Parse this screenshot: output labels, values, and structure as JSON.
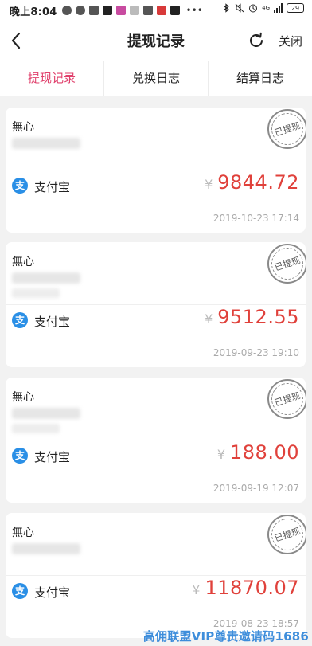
{
  "status_bar": {
    "time": "晚上8:04",
    "dots": "•••",
    "network": "4G",
    "battery": "29"
  },
  "header": {
    "title": "提现记录",
    "close_label": "关闭"
  },
  "tabs": [
    {
      "label": "提现记录",
      "active": true
    },
    {
      "label": "兑换日志",
      "active": false
    },
    {
      "label": "结算日志",
      "active": false
    }
  ],
  "records": [
    {
      "name": "無心",
      "stamp": "已提现",
      "method": "支付宝",
      "currency": "¥",
      "amount": "9844.72",
      "time": "2019-10-23 17:14"
    },
    {
      "name": "無心",
      "stamp": "已提现",
      "method": "支付宝",
      "currency": "¥",
      "amount": "9512.55",
      "time": "2019-09-23 19:10"
    },
    {
      "name": "無心",
      "stamp": "已提现",
      "method": "支付宝",
      "currency": "¥",
      "amount": "188.00",
      "time": "2019-09-19 12:07"
    },
    {
      "name": "無心",
      "stamp": "已提现",
      "method": "支付宝",
      "currency": "¥",
      "amount": "11870.07",
      "time": "2019-08-23 18:57"
    }
  ],
  "watermark": "高佣联盟VIP尊贵邀请码1686",
  "colors": {
    "accent": "#e0406c",
    "amount": "#e0413b",
    "alipay": "#2a8fe6"
  }
}
